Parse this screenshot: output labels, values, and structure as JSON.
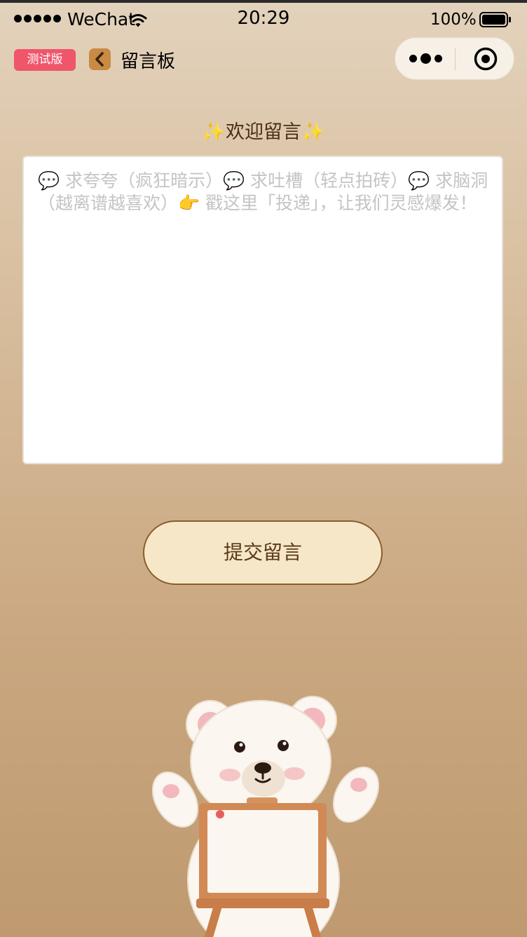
{
  "status_bar": {
    "carrier": "WeChat",
    "time": "20:29",
    "battery": "100%"
  },
  "nav": {
    "badge": "测试版",
    "title": "留言板",
    "icons": [
      "back-chevron-icon",
      "more-icon",
      "close-target-icon"
    ]
  },
  "main": {
    "welcome": "✨欢迎留言✨",
    "message_input": {
      "value": "",
      "placeholder": "💬 求夸夸（疯狂暗示）💬 求吐槽（轻点拍砖）💬 求脑洞（越离谱越喜欢）👉 戳这里「投递」，让我们灵感爆发！"
    },
    "submit_label": "提交留言"
  },
  "colors": {
    "badge": "#f0566b",
    "back_button": "#c98a43",
    "button_fill": "#f6e7c8",
    "button_border": "#8a5e2a",
    "background_top": "#e3d2bc",
    "background_bottom": "#bf9a70"
  }
}
